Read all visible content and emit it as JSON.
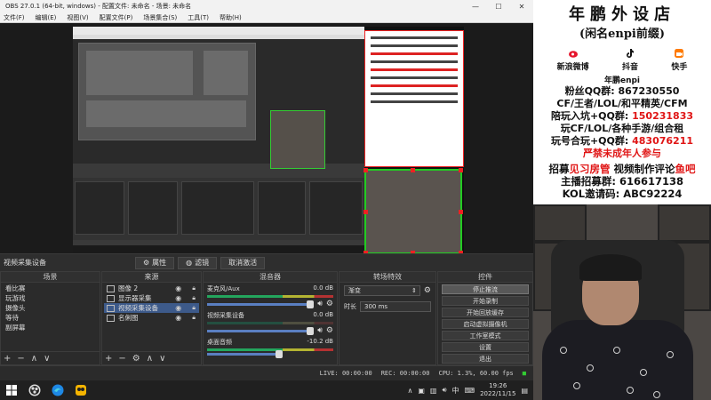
{
  "window": {
    "title": "OBS 27.0.1 (64-bit, windows) - 配置文件: 未命名 - 场景: 未命名",
    "minimize": "—",
    "maximize": "☐",
    "close": "✕"
  },
  "menu": [
    "文件(F)",
    "编辑(E)",
    "视图(V)",
    "配置文件(P)",
    "场景集合(S)",
    "工具(T)",
    "帮助(H)"
  ],
  "source_toolbar": {
    "selected_source": "视频采集设备",
    "properties": "属性",
    "filters": "滤镜",
    "deactivate": "取消激活"
  },
  "scenes": {
    "header": "场景",
    "items": [
      "看比赛",
      "玩游戏",
      "摄像头",
      "等待",
      "副屏幕"
    ]
  },
  "sources": {
    "header": "来源",
    "items": [
      {
        "label": "图像 2",
        "selected": false
      },
      {
        "label": "显示器采集",
        "selected": false
      },
      {
        "label": "视频采集设备",
        "selected": true
      },
      {
        "label": "名俐图",
        "selected": false
      }
    ]
  },
  "mixer": {
    "header": "混音器",
    "channels": [
      {
        "name": "麦克风/Aux",
        "db": "0.0 dB"
      },
      {
        "name": "视频采集设备",
        "db": "0.0 dB"
      },
      {
        "name": "桌面音频",
        "db": "-10.2 dB"
      }
    ]
  },
  "transitions": {
    "header": "转场特效",
    "selected": "渐变",
    "duration_label": "时长",
    "duration": "300 ms"
  },
  "controls": {
    "header": "控件",
    "buttons": [
      {
        "label": "停止推流",
        "active": true
      },
      {
        "label": "开始录制",
        "active": false
      },
      {
        "label": "开始回放缓存",
        "active": false
      },
      {
        "label": "启动虚拟摄像机",
        "active": false
      },
      {
        "label": "工作室模式",
        "active": false
      },
      {
        "label": "设置",
        "active": false
      },
      {
        "label": "退出",
        "active": false
      }
    ]
  },
  "status": {
    "live": "LIVE: 00:00:00",
    "rec": "REC: 00:00:00",
    "cpu": "CPU: 1.3%, 60.00 fps"
  },
  "taskbar": {
    "ime": "中",
    "time": "19:26",
    "date": "2022/11/15",
    "notification": "▤"
  },
  "poster": {
    "title": "年鹏外设店",
    "subtitle": "(闲名enpi前缀)",
    "socials": [
      {
        "label": "新浪微博",
        "icon": "weibo-icon",
        "color": "#e6162d"
      },
      {
        "label": "抖音",
        "icon": "douyin-icon",
        "color": "#111111"
      },
      {
        "label": "快手",
        "icon": "kuaishou-icon",
        "color": "#ff7a00"
      }
    ],
    "name": "年鹏enpi",
    "lines": [
      {
        "prefix": "粉丝QQ群: ",
        "value": "867230550",
        "red": false
      },
      {
        "prefix": "CF/王者/LOL/和平精英/CFM",
        "value": "",
        "red": false
      },
      {
        "prefix": "陪玩入坑+QQ群: ",
        "value": "150231833",
        "red": true
      },
      {
        "prefix": "玩CF/LOL/各种手游/组合租",
        "value": "",
        "red": false
      },
      {
        "prefix": "玩号合玩+QQ群: ",
        "value": "483076211",
        "red": true
      }
    ],
    "warning": "严禁未成年人参与",
    "recruit": {
      "a": "招募",
      "b": "见习房管",
      "c": "视频制作",
      "d": "评论",
      "e": "鱼吧"
    },
    "anchor": "主播招募群: 616617138",
    "kol": "KOL邀请码: ABC92224"
  }
}
